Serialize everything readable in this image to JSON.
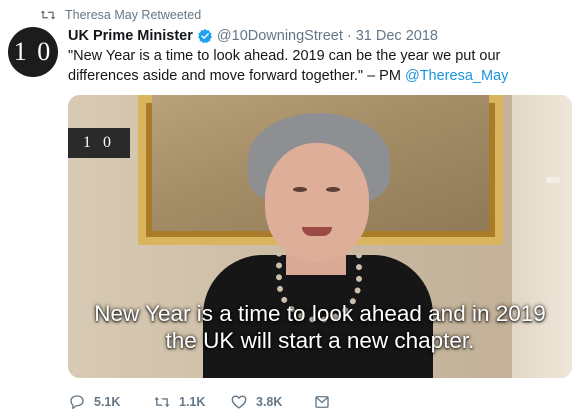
{
  "retweet_context": {
    "label": "Theresa May Retweeted",
    "icon": "retweet-icon"
  },
  "author": {
    "avatar_text": "1 0",
    "name": "UK Prime Minister",
    "verified": true,
    "handle": "@10DowningStreet",
    "separator": "·",
    "date": "31 Dec 2018"
  },
  "tweet": {
    "text_main": "\"New Year is a time to look ahead. 2019 can be the year we put our differences aside and move forward together.\" – PM ",
    "mention": "@Theresa_May"
  },
  "media": {
    "logo_text": "1 0",
    "subtitle_line1": "New Year is a time to look ahead and in 2019",
    "subtitle_line2": "the UK will start a new chapter."
  },
  "actions": {
    "replies": "5.1K",
    "retweets": "1.1K",
    "likes": "3.8K",
    "icons": [
      "reply-icon",
      "retweet-icon",
      "like-icon",
      "direct-message-icon"
    ]
  },
  "colors": {
    "link": "#1b95e0",
    "secondary_text": "#657786",
    "verified_badge": "#1da1f2"
  }
}
